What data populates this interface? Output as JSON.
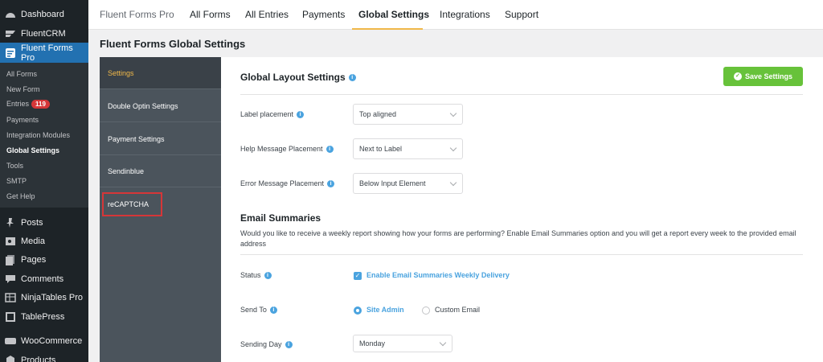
{
  "wp_menu": {
    "items": [
      {
        "label": "Dashboard",
        "icon": "dashboard-icon"
      },
      {
        "label": "FluentCRM",
        "icon": "fluentcrm-icon"
      },
      {
        "label": "Fluent Forms Pro",
        "icon": "fluent-forms-icon"
      },
      {
        "label": "Posts",
        "icon": "pin-icon"
      },
      {
        "label": "Media",
        "icon": "media-icon"
      },
      {
        "label": "Pages",
        "icon": "pages-icon"
      },
      {
        "label": "Comments",
        "icon": "comments-icon"
      },
      {
        "label": "NinjaTables Pro",
        "icon": "table-icon"
      },
      {
        "label": "TablePress",
        "icon": "tablepress-icon"
      },
      {
        "label": "WooCommerce",
        "icon": "woocommerce-icon"
      },
      {
        "label": "Products",
        "icon": "products-icon"
      }
    ],
    "submenu": [
      {
        "label": "All Forms"
      },
      {
        "label": "New Form"
      },
      {
        "label": "Entries",
        "badge": "119"
      },
      {
        "label": "Payments"
      },
      {
        "label": "Integration Modules"
      },
      {
        "label": "Global Settings"
      },
      {
        "label": "Tools"
      },
      {
        "label": "SMTP"
      },
      {
        "label": "Get Help"
      }
    ]
  },
  "topnav": {
    "brand": "Fluent Forms Pro",
    "tabs": [
      "All Forms",
      "All Entries",
      "Payments",
      "Global Settings",
      "Integrations",
      "Support"
    ]
  },
  "page_heading": "Fluent Forms Global Settings",
  "settings_nav": [
    "Settings",
    "Double Optin Settings",
    "Payment Settings",
    "Sendinblue",
    "reCAPTCHA"
  ],
  "layout": {
    "title": "Global Layout Settings",
    "save_label": "Save Settings",
    "fields": [
      {
        "label": "Label placement",
        "value": "Top aligned"
      },
      {
        "label": "Help Message Placement",
        "value": "Next to Label"
      },
      {
        "label": "Error Message Placement",
        "value": "Below Input Element"
      }
    ]
  },
  "email": {
    "title": "Email Summaries",
    "description": "Would you like to receive a weekly report showing how your forms are performing? Enable Email Summaries option and you will get a report every week to the provided email address",
    "status_label": "Status",
    "status_check_label": "Enable Email Summaries Weekly Delivery",
    "send_to_label": "Send To",
    "radio_site_admin": "Site Admin",
    "radio_custom_email": "Custom Email",
    "sending_day_label": "Sending Day",
    "sending_day_value": "Monday"
  },
  "colors": {
    "accent": "#2271b1",
    "save_green": "#67c23a",
    "info_blue": "#4aa3df",
    "active_tab_underline": "#f0b849",
    "highlight_red": "#d63638"
  }
}
